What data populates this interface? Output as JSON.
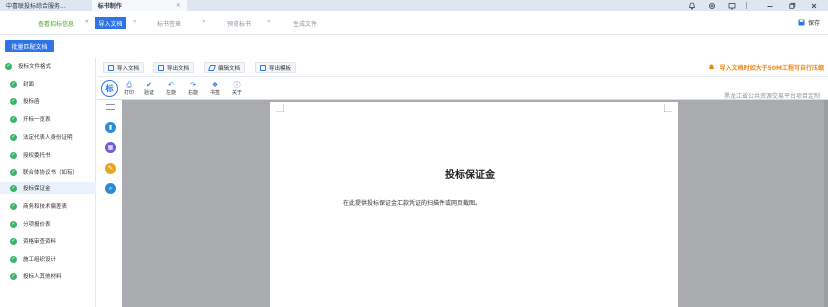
{
  "window": {
    "tabs": [
      {
        "label": "中喜联投标综合服务...",
        "active": false
      },
      {
        "label": "标书制作",
        "active": true,
        "close": "×"
      }
    ],
    "controls": [
      "bell-icon",
      "gear-icon",
      "screen-icon",
      "minimize-icon",
      "maximize-icon",
      "close-icon"
    ]
  },
  "steps": {
    "items": [
      {
        "label": "查看招标信息",
        "state": "done"
      },
      {
        "label": "导入文档",
        "state": "current"
      },
      {
        "label": "标书签章",
        "state": "todo"
      },
      {
        "label": "预览标书",
        "state": "todo"
      },
      {
        "label": "生成文件",
        "state": "todo"
      }
    ],
    "arrow": "»",
    "save_label": "保存"
  },
  "batch_button": "批量匹配文档",
  "sidebar": {
    "root": "投标文件格式",
    "items": [
      "封面",
      "投标函",
      "开标一览表",
      "法定代表人身份证明",
      "授权委托书",
      "联合体协议书（如有）",
      "投标保证金",
      "商务和技术偏差表",
      "分项报价表",
      "资格审查资料",
      "施工组织设计",
      "投标人其他材料"
    ],
    "active_index": 6
  },
  "toolbar": {
    "buttons": [
      "导入文档",
      "导出文档",
      "编辑文档",
      "导出模板"
    ],
    "warning": "导入文档时如大于50M工程可自行压缩"
  },
  "editor": {
    "logo": "标",
    "buttons": [
      "打印",
      "验证",
      "左旋",
      "右旋",
      "书签",
      "关于"
    ],
    "brand_note": "黑龙江省公共资源交易平台项目定制"
  },
  "document": {
    "title": "投标保证金",
    "body": "在此提供投标保证金汇款凭证的扫描件或网页截图。"
  },
  "colors": {
    "accent": "#2e74e6",
    "done": "#54a22f",
    "success": "#3bb46a",
    "warning": "#e98a1c"
  }
}
